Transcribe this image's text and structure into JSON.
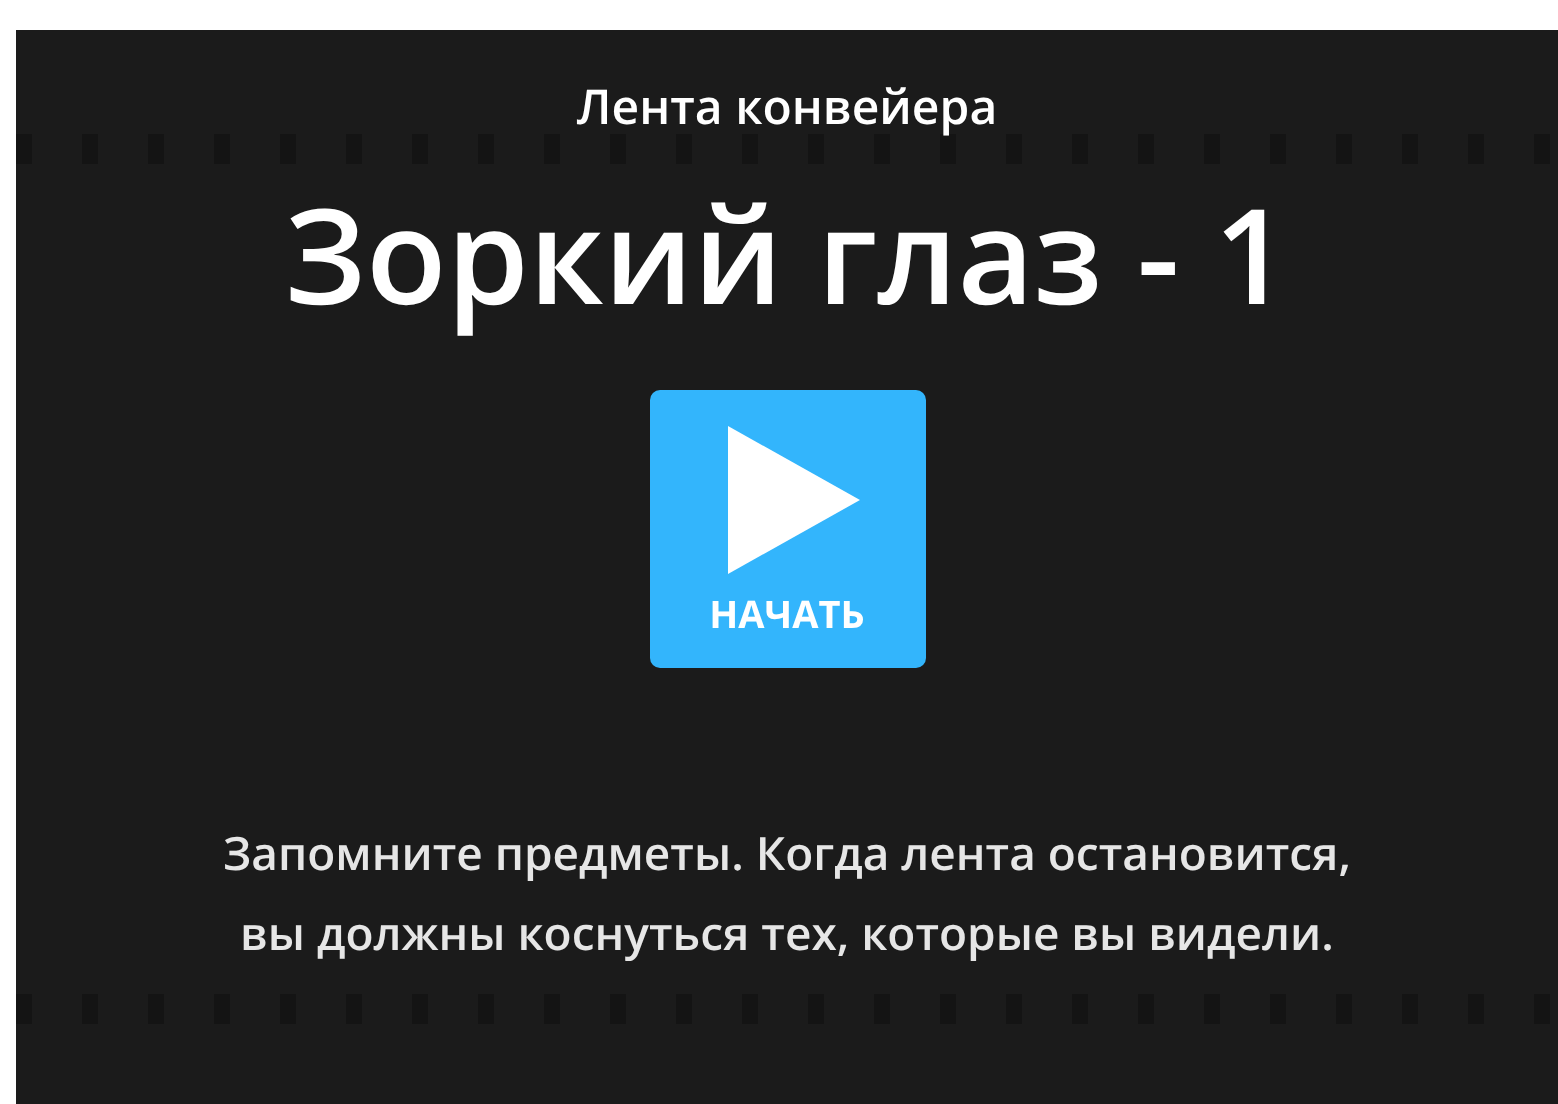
{
  "subtitle": "Лента конвейера",
  "title": "Зоркий глаз - 1",
  "start_button": {
    "label": "НАЧАТЬ"
  },
  "instructions": [
    "Запомните предметы. Когда лента остановится,",
    "вы должны коснуться тех, которые вы видели."
  ]
}
